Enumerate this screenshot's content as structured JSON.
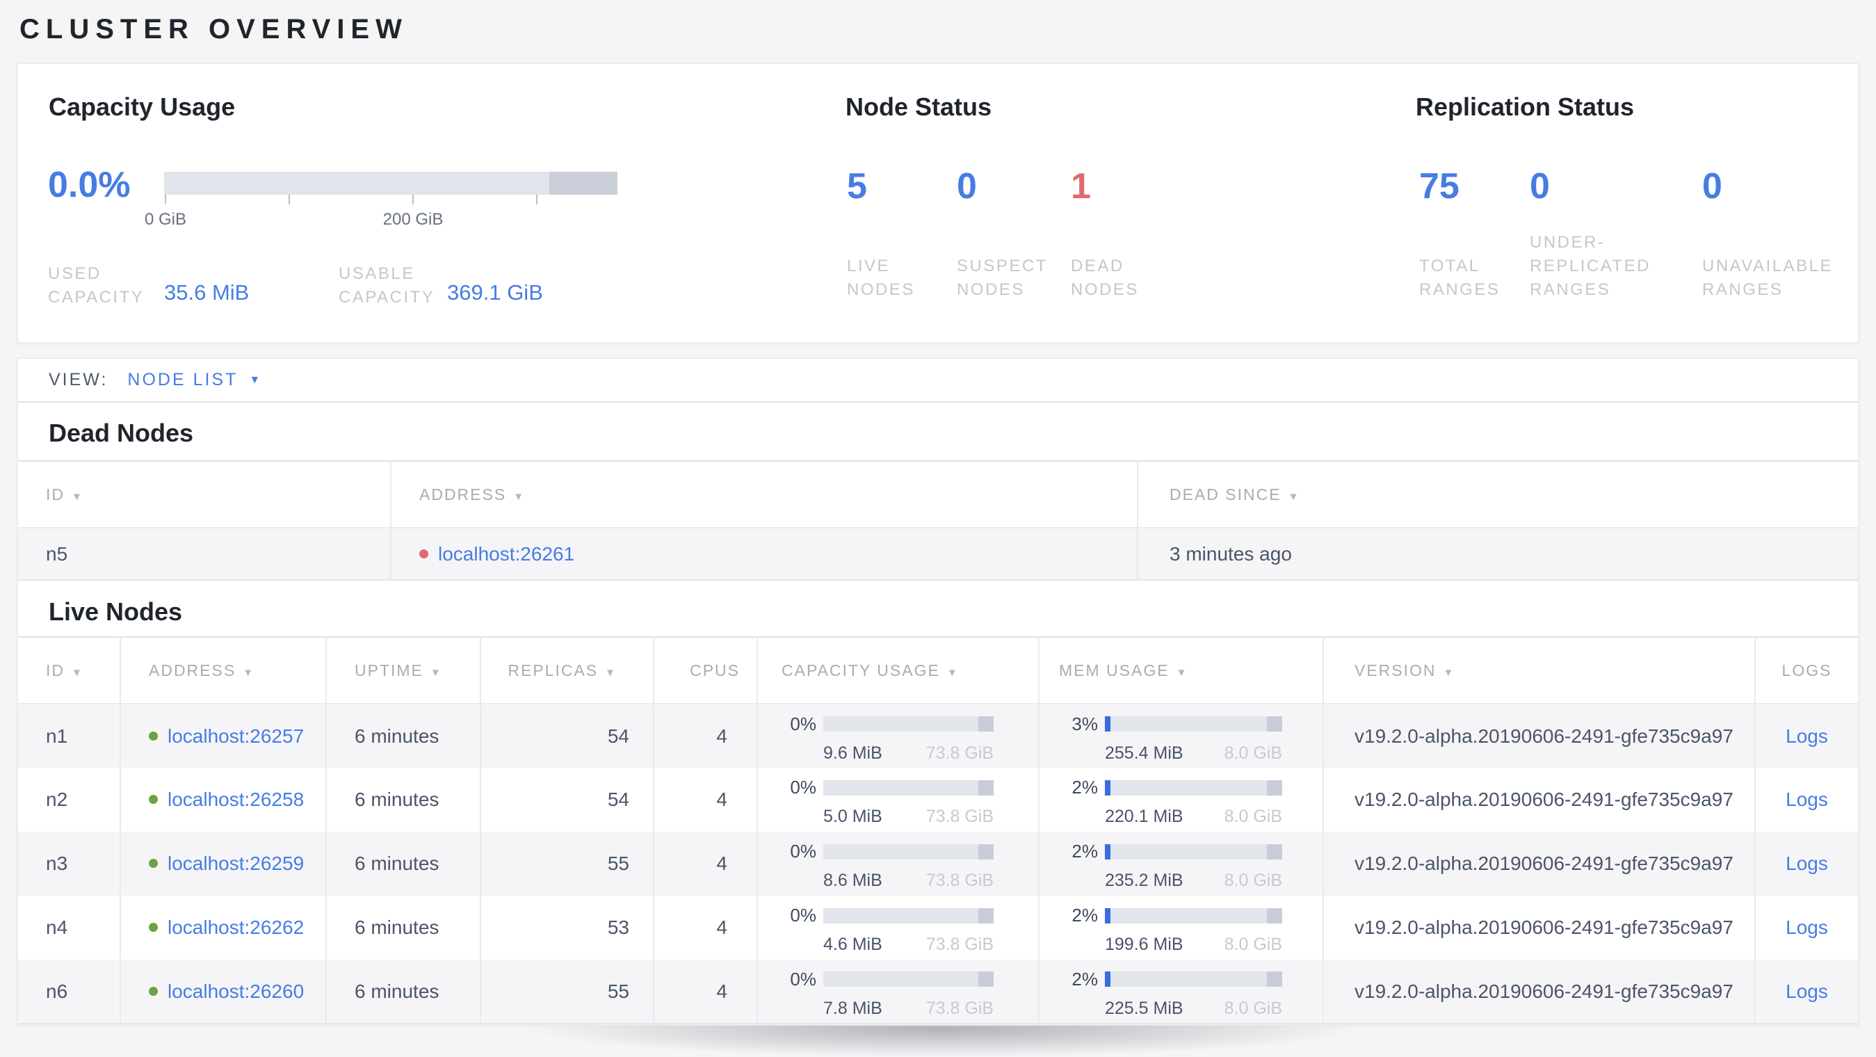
{
  "page": {
    "title": "CLUSTER OVERVIEW"
  },
  "colors": {
    "accent_blue": "#467ce3",
    "dead_red": "#df6a6e",
    "live_green": "#6da33d"
  },
  "summary": {
    "capacity": {
      "heading": "Capacity Usage",
      "percent": "0.0%",
      "ticks": [
        "0 GiB",
        "200 GiB"
      ],
      "stats": [
        {
          "label": "USED CAPACITY",
          "value": "35.6 MiB"
        },
        {
          "label": "USABLE CAPACITY",
          "value": "369.1 GiB"
        }
      ]
    },
    "nodes": {
      "heading": "Node Status",
      "stats": [
        {
          "value": "5",
          "label": "LIVE NODES"
        },
        {
          "value": "0",
          "label": "SUSPECT NODES"
        },
        {
          "value": "1",
          "label": "DEAD NODES"
        }
      ]
    },
    "replication": {
      "heading": "Replication Status",
      "stats": [
        {
          "value": "75",
          "label": "TOTAL RANGES"
        },
        {
          "value": "0",
          "label": "UNDER-REPLICATED RANGES"
        },
        {
          "value": "0",
          "label": "UNAVAILABLE RANGES"
        }
      ]
    }
  },
  "view_bar": {
    "label": "VIEW:",
    "selected": "NODE LIST"
  },
  "dead_nodes": {
    "heading": "Dead Nodes",
    "columns": [
      "ID",
      "ADDRESS",
      "DEAD SINCE"
    ],
    "rows": [
      {
        "id": "n5",
        "address": "localhost:26261",
        "dead_since": "3 minutes ago"
      }
    ]
  },
  "live_nodes": {
    "heading": "Live Nodes",
    "columns": [
      "ID",
      "ADDRESS",
      "UPTIME",
      "REPLICAS",
      "CPUS",
      "CAPACITY USAGE",
      "MEM USAGE",
      "VERSION",
      "LOGS"
    ],
    "rows": [
      {
        "id": "n1",
        "address": "localhost:26257",
        "uptime": "6 minutes",
        "replicas": "54",
        "cpus": "4",
        "capacity": {
          "pct": "0%",
          "used": "9.6 MiB",
          "total": "73.8 GiB"
        },
        "memory": {
          "pct": "3%",
          "used": "255.4 MiB",
          "total": "8.0 GiB"
        },
        "version": "v19.2.0-alpha.20190606-2491-gfe735c9a97",
        "logs": "Logs"
      },
      {
        "id": "n2",
        "address": "localhost:26258",
        "uptime": "6 minutes",
        "replicas": "54",
        "cpus": "4",
        "capacity": {
          "pct": "0%",
          "used": "5.0 MiB",
          "total": "73.8 GiB"
        },
        "memory": {
          "pct": "2%",
          "used": "220.1 MiB",
          "total": "8.0 GiB"
        },
        "version": "v19.2.0-alpha.20190606-2491-gfe735c9a97",
        "logs": "Logs"
      },
      {
        "id": "n3",
        "address": "localhost:26259",
        "uptime": "6 minutes",
        "replicas": "55",
        "cpus": "4",
        "capacity": {
          "pct": "0%",
          "used": "8.6 MiB",
          "total": "73.8 GiB"
        },
        "memory": {
          "pct": "2%",
          "used": "235.2 MiB",
          "total": "8.0 GiB"
        },
        "version": "v19.2.0-alpha.20190606-2491-gfe735c9a97",
        "logs": "Logs"
      },
      {
        "id": "n4",
        "address": "localhost:26262",
        "uptime": "6 minutes",
        "replicas": "53",
        "cpus": "4",
        "capacity": {
          "pct": "0%",
          "used": "4.6 MiB",
          "total": "73.8 GiB"
        },
        "memory": {
          "pct": "2%",
          "used": "199.6 MiB",
          "total": "8.0 GiB"
        },
        "version": "v19.2.0-alpha.20190606-2491-gfe735c9a97",
        "logs": "Logs"
      },
      {
        "id": "n6",
        "address": "localhost:26260",
        "uptime": "6 minutes",
        "replicas": "55",
        "cpus": "4",
        "capacity": {
          "pct": "0%",
          "used": "7.8 MiB",
          "total": "73.8 GiB"
        },
        "memory": {
          "pct": "2%",
          "used": "225.5 MiB",
          "total": "8.0 GiB"
        },
        "version": "v19.2.0-alpha.20190606-2491-gfe735c9a97",
        "logs": "Logs"
      }
    ]
  }
}
